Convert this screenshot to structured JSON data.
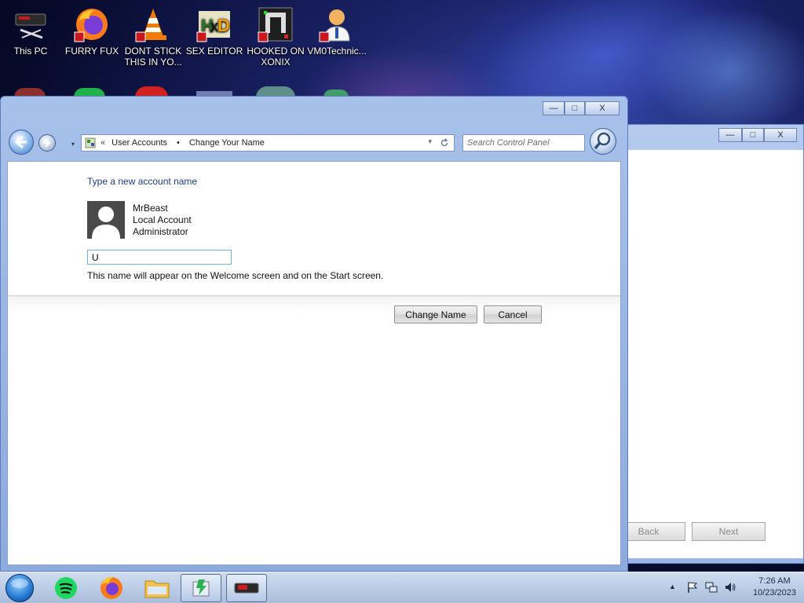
{
  "desktop": {
    "icons": [
      {
        "label": "This PC"
      },
      {
        "label": "FURRY FUX"
      },
      {
        "label": "DONT STICK THIS IN YO..."
      },
      {
        "label": "SEX EDITOR"
      },
      {
        "label": "HOOKED ON XONIX"
      },
      {
        "label": "VM0Technic..."
      }
    ]
  },
  "window": {
    "breadcrumb": {
      "prefix": "«",
      "parent": "User Accounts",
      "separator": "•",
      "current": "Change Your Name"
    },
    "search_placeholder": "Search Control Panel",
    "caption": {
      "minimize": "—",
      "maximize": "□",
      "close": "X"
    }
  },
  "content": {
    "heading": "Type a new account name",
    "account": {
      "name": "MrBeast",
      "type": "Local Account",
      "role": "Administrator"
    },
    "new_name_value": "U",
    "hint": "This name will appear on the Welcome screen and on the Start screen.",
    "buttons": {
      "change_name": "Change Name",
      "cancel": "Cancel"
    }
  },
  "background_window": {
    "back_label": "Back",
    "next_label": "Next",
    "caption": {
      "minimize": "—",
      "maximize": "□",
      "close": "X"
    }
  },
  "taskbar": {
    "time": "7:26 AM",
    "date": "10/23/2023"
  },
  "colors": {
    "accent": "#1e3b8a",
    "frame": "#8cabde",
    "taskbar": "#bcd0ea"
  }
}
